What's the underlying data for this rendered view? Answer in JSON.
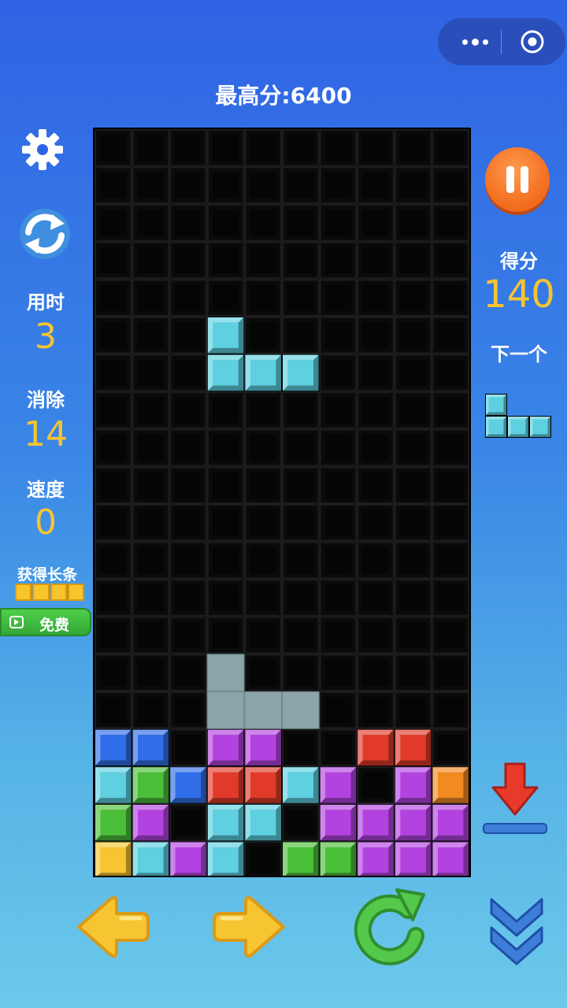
{
  "header": {
    "best_score_label": "最高分:",
    "best_score_value": "6400",
    "menu_icon": "more-dots-icon",
    "close_icon": "target-icon"
  },
  "stats": {
    "time_label": "用时",
    "time_value": "3",
    "cleared_label": "消除",
    "cleared_value": "14",
    "speed_label": "速度",
    "speed_value": "0",
    "score_label": "得分",
    "score_value": "140",
    "next_label": "下一个"
  },
  "bonus": {
    "label": "获得长条",
    "button_label": "免费"
  },
  "colors": {
    "blue": "#2f6ee8",
    "cyan": "#5ed0e0",
    "green": "#4cbf3a",
    "red": "#e23a2a",
    "purple": "#b343e0",
    "orange": "#f28a22",
    "yellow": "#f6c531",
    "ghost": "#8aa4a8",
    "score_accent": "#f6c431"
  },
  "board": {
    "cols": 10,
    "rows": 20,
    "active_piece": {
      "color": "cyan",
      "cells": [
        [
          3,
          5
        ],
        [
          3,
          6
        ],
        [
          4,
          6
        ],
        [
          5,
          6
        ]
      ]
    },
    "ghost_piece": {
      "color": "ghost",
      "cells": [
        [
          3,
          14
        ],
        [
          3,
          15
        ],
        [
          4,
          15
        ],
        [
          5,
          15
        ]
      ]
    },
    "locked": [
      {
        "row": 16,
        "cells": [
          "blue",
          "blue",
          null,
          "purple",
          "purple",
          null,
          null,
          "red",
          "red",
          null
        ]
      },
      {
        "row": 17,
        "cells": [
          "cyan",
          "green",
          "blue",
          "red",
          "red",
          "cyan",
          "purple",
          null,
          "purple",
          "orange"
        ]
      },
      {
        "row": 18,
        "cells": [
          "green",
          "purple",
          null,
          "cyan",
          "cyan",
          null,
          "purple",
          "purple",
          "purple",
          "purple"
        ]
      },
      {
        "row": 19,
        "cells": [
          "yellow",
          "cyan",
          "purple",
          "cyan",
          null,
          "green",
          "green",
          "purple",
          "purple",
          "purple"
        ]
      }
    ]
  },
  "next_piece": {
    "color": "cyan",
    "cells": [
      [
        0,
        0
      ],
      [
        0,
        1
      ],
      [
        1,
        1
      ],
      [
        2,
        1
      ]
    ]
  },
  "controls": {
    "left_icon": "arrow-left-icon",
    "right_icon": "arrow-right-icon",
    "rotate_icon": "rotate-icon",
    "down_icon": "double-chevron-down-icon",
    "drop_icon": "hard-drop-icon",
    "pause_icon": "pause-icon",
    "settings_icon": "gear-icon",
    "restart_icon": "refresh-icon"
  }
}
